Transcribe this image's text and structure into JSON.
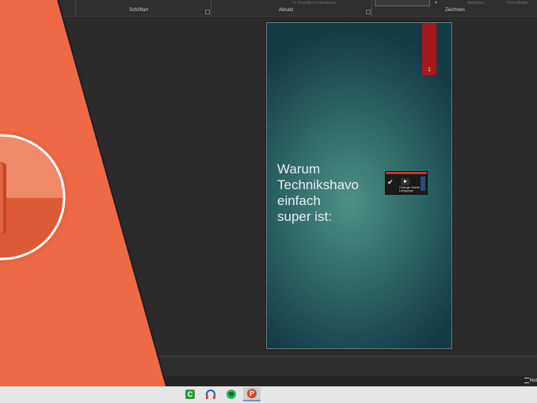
{
  "ribbon": {
    "groups": [
      {
        "label": "Schriftart"
      },
      {
        "label": "Absatz"
      },
      {
        "label": "Zeichnen"
      }
    ],
    "ghost_text": {
      "smartart": "In SmartArt konvertieren",
      "arrange": "Anordnen",
      "effects": "Formeffekte"
    }
  },
  "slide": {
    "number": "1",
    "title_lines": [
      "Warum",
      "Technikshavo",
      "einfach",
      "super ist:"
    ],
    "video": {
      "caption_line1": "Change Game",
      "caption_line2": "Language"
    }
  },
  "status": {
    "notes_label": "Not"
  },
  "taskbar": {
    "apps": [
      {
        "name": "camtasia",
        "glyph": "C",
        "color": "#2e9e3a"
      },
      {
        "name": "audacity",
        "glyph": "",
        "color": "#2a56c6"
      },
      {
        "name": "spotify",
        "glyph": "",
        "color": "#1db954"
      },
      {
        "name": "powerpoint",
        "glyph": "P",
        "color": "#d24726"
      }
    ]
  },
  "colors": {
    "accent_orange": "#ee6a47",
    "slide_tag": "#a5191c",
    "slide_bg": "#2f6a68"
  }
}
